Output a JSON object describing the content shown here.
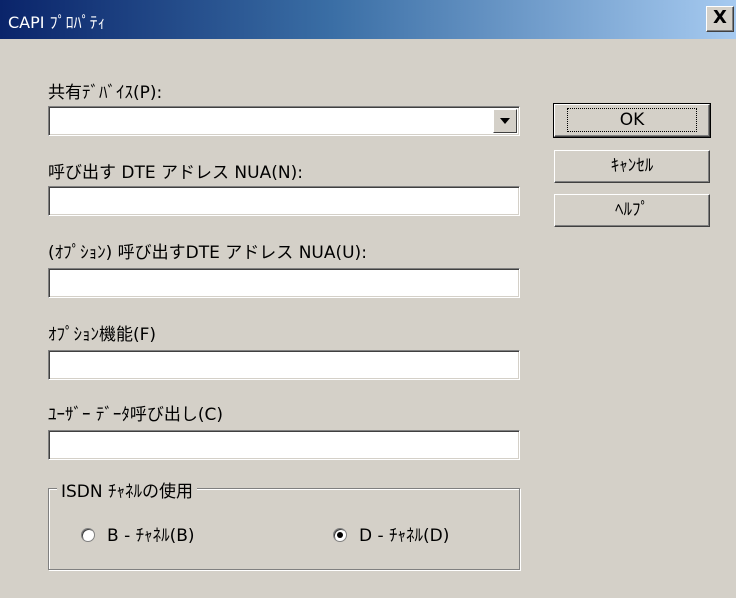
{
  "window": {
    "title": "CAPI ﾌﾟﾛﾊﾟﾃｨ",
    "close_glyph": "X"
  },
  "fields": {
    "shared_device": {
      "label": "共有ﾃﾞﾊﾞｲｽ(P):",
      "value": ""
    },
    "called_dte_nua": {
      "label": "呼び出す DTE アドレス NUA(N):",
      "value": ""
    },
    "optional_called_dte_nua": {
      "label": "(ｵﾌﾟｼｮﾝ) 呼び出すDTE アドレス NUA(U):",
      "value": ""
    },
    "optional_facilities": {
      "label": "ｵﾌﾟｼｮﾝ機能(F)",
      "value": ""
    },
    "user_data_call": {
      "label": "ﾕｰｻﾞｰ ﾃﾞｰﾀ呼び出し(C)",
      "value": ""
    }
  },
  "buttons": {
    "ok": "OK",
    "cancel": "ｷｬﾝｾﾙ",
    "help": "ﾍﾙﾌﾟ"
  },
  "isdn_group": {
    "legend": "ISDN ﾁｬﾈﾙの使用",
    "options": [
      {
        "label": "B - ﾁｬﾈﾙ(B)",
        "checked": false
      },
      {
        "label": "D - ﾁｬﾈﾙ(D)",
        "checked": true
      }
    ]
  },
  "colors": {
    "face": "#d4d0c8",
    "title_start": "#0a246a",
    "title_end": "#a6caf0"
  },
  "icons": {
    "dropdown": "chevron-down-icon",
    "close": "close-icon"
  }
}
